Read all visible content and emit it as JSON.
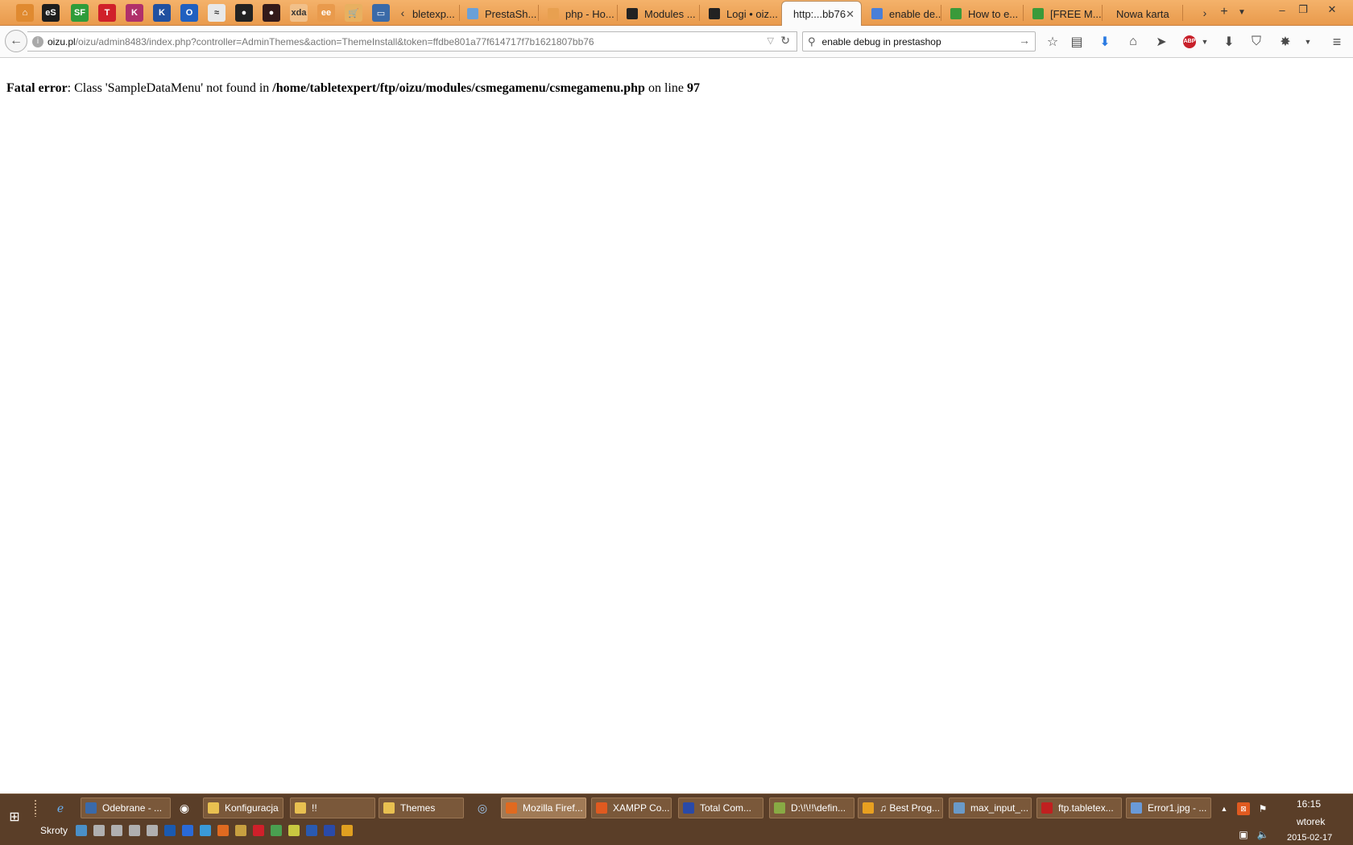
{
  "browser": {
    "pinned_tabs": [
      {
        "icon": "home-lock-icon",
        "text": "⌂",
        "color": "#e08a30"
      },
      {
        "icon": "es-icon",
        "text": "eS",
        "color": "#1d1d1d"
      },
      {
        "icon": "sf-icon",
        "text": "SF",
        "color": "#2e9c3a"
      },
      {
        "icon": "red-square-icon",
        "text": "T",
        "color": "#d0202a"
      },
      {
        "icon": "k-pink-icon",
        "text": "K",
        "color": "#b0306a"
      },
      {
        "icon": "k-blue-icon",
        "text": "K",
        "color": "#2050a0"
      },
      {
        "icon": "blue-square-icon",
        "text": "O",
        "color": "#2060c0"
      },
      {
        "icon": "chart-icon",
        "text": "≈",
        "color": "#e8e8e8"
      },
      {
        "icon": "face-icon",
        "text": "●",
        "color": "#222222"
      },
      {
        "icon": "face-dark-icon",
        "text": "●",
        "color": "#331a1a"
      },
      {
        "icon": "xda-icon",
        "text": "xda",
        "color": "#f1c08a"
      },
      {
        "icon": "ee-icon",
        "text": "ee",
        "color": "#e99a4c"
      },
      {
        "icon": "cart-icon",
        "text": "🛒",
        "color": "#e8b060"
      },
      {
        "icon": "monitor-icon",
        "text": "▭",
        "color": "#3a6aa8"
      }
    ],
    "tabs": [
      {
        "label": "bletexp...",
        "icon": "",
        "color": "#000000"
      },
      {
        "label": "PrestaSh...",
        "icon": "prestashop-icon",
        "color": "#6aa0d8"
      },
      {
        "label": "php - Ho...",
        "icon": "stackoverflow-icon",
        "color": "#e8a050"
      },
      {
        "label": "Modules ...",
        "icon": "prestashop-admin-icon",
        "color": "#222222"
      },
      {
        "label": "Logi • oiz...",
        "icon": "prestashop-admin-icon",
        "color": "#222222"
      },
      {
        "label": "http:...bb76",
        "icon": "",
        "color": "#ffffff",
        "active": true
      },
      {
        "label": "enable de...",
        "icon": "google-icon",
        "color": "#4a7fd8"
      },
      {
        "label": "How to e...",
        "icon": "leaf-icon",
        "color": "#3a9a3a"
      },
      {
        "label": "[FREE M...",
        "icon": "leaf-icon",
        "color": "#3a9a3a"
      },
      {
        "label": "Nowa karta",
        "icon": "",
        "color": "#ffffff"
      }
    ],
    "url_domain": "oizu.pl",
    "url_path": "/oizu/admin8483/index.php?controller=AdminThemes&action=ThemeInstall&token=ffdbe801a77f614717f7b1621807bb76",
    "search_value": "enable debug in prestashop",
    "toolbar_icons": [
      "star-icon",
      "reader-icon",
      "download-arrow-icon",
      "home-icon",
      "send-icon",
      "adblock-icon",
      "download-icon",
      "shield-icon",
      "addon-icon",
      "dropdown-icon",
      "menu-icon"
    ]
  },
  "page": {
    "error_label": "Fatal error",
    "error_message": ": Class 'SampleDataMenu' not found in ",
    "error_file": "/home/tabletexpert/ftp/oizu/modules/csmegamenu/csmegamenu.php",
    "error_line_prefix": " on line ",
    "error_line_number": "97"
  },
  "taskbar": {
    "buttons": [
      {
        "label": "Odebrane - ...",
        "icon": "thunderbird-icon",
        "color": "#3a6aaa"
      },
      {
        "label": "Konfiguracja",
        "icon": "folder-icon",
        "color": "#e8c050"
      },
      {
        "label": "!!",
        "icon": "folder-icon",
        "color": "#e8c050"
      },
      {
        "label": "Themes",
        "icon": "folder-icon",
        "color": "#e8c050"
      },
      {
        "label": "Mozilla Firef...",
        "icon": "firefox-icon",
        "color": "#e06a20",
        "active": true
      },
      {
        "label": "XAMPP Co...",
        "icon": "xampp-icon",
        "color": "#e05a20"
      },
      {
        "label": "Total Com...",
        "icon": "totalcmd-icon",
        "color": "#2a4aa8"
      },
      {
        "label": "D:\\!\\!!\\defin...",
        "icon": "notepad-icon",
        "color": "#88aa44"
      },
      {
        "label": "♫ Best Prog...",
        "icon": "aimp-icon",
        "color": "#e8a020"
      },
      {
        "label": "max_input_...",
        "icon": "notepad-icon",
        "color": "#6a9ac8"
      },
      {
        "label": "ftp.tabletex...",
        "icon": "filezilla-icon",
        "color": "#c02020"
      },
      {
        "label": "Error1.jpg - ...",
        "icon": "image-viewer-icon",
        "color": "#6a9ad8"
      }
    ],
    "quick_launch_label": "Skroty",
    "clock_time": "16:15",
    "clock_day": "wtorek",
    "clock_date": "2015-02-17"
  }
}
